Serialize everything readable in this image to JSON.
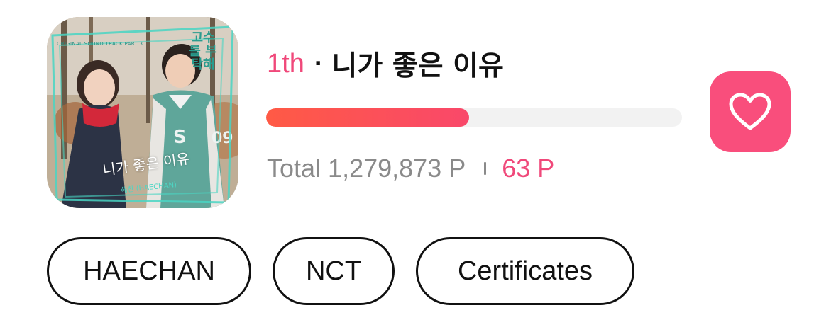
{
  "album": {
    "ost_series_title": "고수를 부탁해",
    "ost_small_text": "ORIGINAL SOUND TRACK PART 3",
    "cover_song_text": "니가 좋은 이유",
    "cover_artist_text": "해찬 (HAECHAN)"
  },
  "song": {
    "rank": "1th",
    "separator": "·",
    "title": "니가 좋은 이유"
  },
  "progress": {
    "fraction": 0.488,
    "color_start": "#ff5a45",
    "color_end": "#f9486a"
  },
  "points": {
    "total_label": "Total 1,279,873 P",
    "my_points": "63 P"
  },
  "heart_button": {
    "icon": "heart-outline-icon",
    "color": "#f94e7c"
  },
  "tags": [
    {
      "label": "HAECHAN"
    },
    {
      "label": "NCT"
    },
    {
      "label": "Certificates"
    }
  ],
  "colors": {
    "accent": "#f0487a",
    "muted_text": "#8a8a8a"
  }
}
